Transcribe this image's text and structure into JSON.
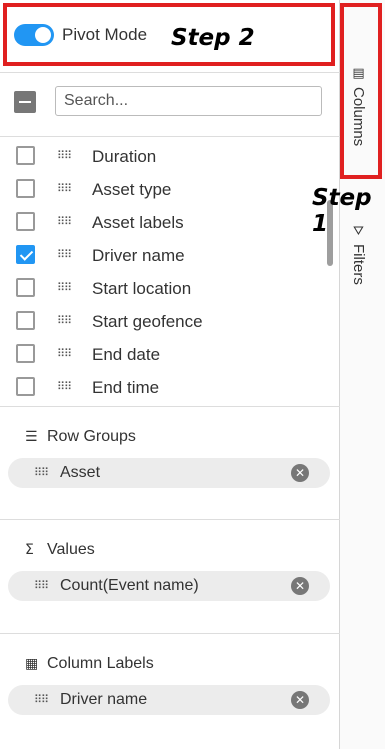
{
  "pivot": {
    "label": "Pivot Mode",
    "enabled": true
  },
  "annotations": {
    "step1": "Step 1",
    "step2": "Step 2"
  },
  "search": {
    "placeholder": "Search..."
  },
  "columns": [
    {
      "label": "Duration",
      "checked": false
    },
    {
      "label": "Asset type",
      "checked": false
    },
    {
      "label": "Asset labels",
      "checked": false
    },
    {
      "label": "Driver name",
      "checked": true
    },
    {
      "label": "Start location",
      "checked": false
    },
    {
      "label": "Start geofence",
      "checked": false
    },
    {
      "label": "End date",
      "checked": false
    },
    {
      "label": "End time",
      "checked": false
    }
  ],
  "sections": {
    "row_groups": {
      "title": "Row Groups",
      "chip": "Asset"
    },
    "values": {
      "title": "Values",
      "chip": "Count(Event name)"
    },
    "column_labels": {
      "title": "Column Labels",
      "chip": "Driver name"
    }
  },
  "side_tabs": {
    "columns": "Columns",
    "filters": "Filters"
  },
  "colors": {
    "accent": "#2196f3",
    "highlight": "#e02020"
  }
}
